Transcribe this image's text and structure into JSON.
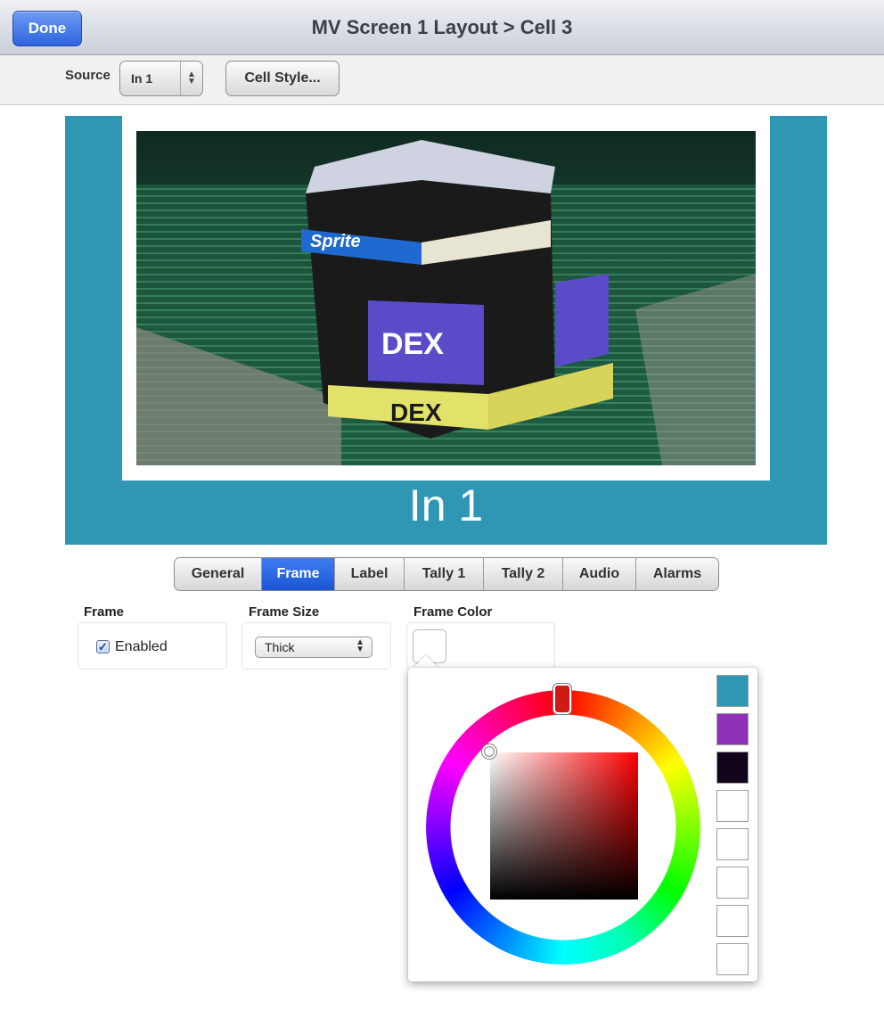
{
  "header": {
    "done_label": "Done",
    "title": "MV Screen 1 Layout > Cell 3"
  },
  "toolbar": {
    "source_label": "Source",
    "source_value": "In 1",
    "cell_style_label": "Cell Style..."
  },
  "preview": {
    "label": "In 1",
    "background_color": "#2f97b3"
  },
  "tabs": [
    {
      "label": "General",
      "active": false
    },
    {
      "label": "Frame",
      "active": true
    },
    {
      "label": "Label",
      "active": false
    },
    {
      "label": "Tally 1",
      "active": false
    },
    {
      "label": "Tally 2",
      "active": false
    },
    {
      "label": "Audio",
      "active": false
    },
    {
      "label": "Alarms",
      "active": false
    }
  ],
  "frame": {
    "frame_label": "Frame",
    "enabled_label": "Enabled",
    "enabled_checked": true,
    "frame_size_label": "Frame Size",
    "frame_size_value": "Thick",
    "frame_color_label": "Frame Color",
    "frame_color_value": "#ffffff"
  },
  "color_picker": {
    "selected_hue": "#d01a14",
    "presets": [
      "#2f97b3",
      "#9030b8",
      "#12041a",
      "#ffffff",
      "#ffffff",
      "#ffffff",
      "#ffffff",
      "#ffffff"
    ]
  }
}
